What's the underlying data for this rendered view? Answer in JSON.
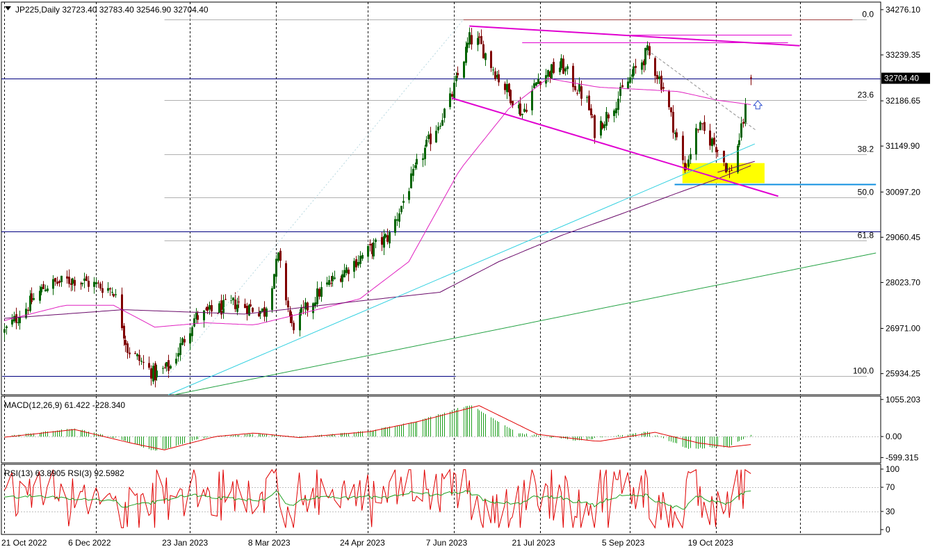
{
  "header": {
    "menu_icon": "triangle-down-icon",
    "symbol_line": "JP225,Daily  32723.40 32783.40 32546.90 32704.40"
  },
  "colors": {
    "bull_candle": "#006400",
    "bear_candle": "#800000",
    "ma_fast": "#e020c0",
    "ma_slow": "#6a0a6a",
    "trend_magenta": "#e000d0",
    "trend_cyan": "#30d0e0",
    "trend_green": "#20a040",
    "horizontal_navy": "#000080",
    "fib_grey": "#b0b0b0",
    "zone_yellow": "#ffff00",
    "support_blue": "#1090e0",
    "top_red": "#a04040",
    "macd_hist": "#20a020",
    "macd_signal": "#e00000",
    "rsi_fast": "#e00000",
    "rsi_slow": "#20a020",
    "price_tag_bg": "#000000",
    "cursor_arrow": "#3050d0"
  },
  "chart_data": [
    {
      "type": "candlestick",
      "name": "main",
      "symbol": "JP225",
      "timeframe": "Daily",
      "ohlc_current": {
        "open": 32723.4,
        "high": 32783.4,
        "low": 32546.9,
        "close": 32704.4
      },
      "current_price_label": "32704.40",
      "ylim": [
        25450,
        34450
      ],
      "y_ticks": [
        34276.1,
        33239.35,
        32186.65,
        31149.9,
        30097.2,
        29060.45,
        28023.7,
        26971.0,
        25934.25
      ],
      "y_tick_labels": [
        "34276.10",
        "33239.35",
        "32186.65",
        "31149.90",
        "30097.20",
        "29060.45",
        "28023.70",
        "26971.00",
        "25934.25"
      ],
      "x_labels": [
        "21 Oct 2022",
        "6 Dec 2022",
        "23 Jan 2023",
        "8 Mar 2023",
        "24 Apr 2023",
        "7 Jun 2023",
        "21 Jul 2023",
        "5 Sep 2023",
        "19 Oct 2023"
      ],
      "fib_levels": [
        {
          "label": "0.0",
          "price": 34050
        },
        {
          "label": "23.6",
          "price": 32200
        },
        {
          "label": "38.2",
          "price": 30960
        },
        {
          "label": "50.0",
          "price": 29980
        },
        {
          "label": "61.8",
          "price": 28980
        },
        {
          "label": "100.0",
          "price": 25880
        }
      ],
      "key_points": [
        {
          "date": "2022-10-20",
          "price": 26900
        },
        {
          "date": "2022-11-10",
          "price": 27950
        },
        {
          "date": "2022-11-25",
          "price": 28100
        },
        {
          "date": "2022-12-15",
          "price": 27850
        },
        {
          "date": "2022-12-22",
          "price": 26500
        },
        {
          "date": "2023-01-05",
          "price": 25900
        },
        {
          "date": "2023-01-13",
          "price": 26100
        },
        {
          "date": "2023-01-25",
          "price": 27200
        },
        {
          "date": "2023-02-15",
          "price": 27550
        },
        {
          "date": "2023-03-02",
          "price": 27350
        },
        {
          "date": "2023-03-09",
          "price": 28600
        },
        {
          "date": "2023-03-16",
          "price": 27000
        },
        {
          "date": "2023-03-30",
          "price": 27800
        },
        {
          "date": "2023-04-20",
          "price": 28600
        },
        {
          "date": "2023-05-05",
          "price": 29100
        },
        {
          "date": "2023-05-20",
          "price": 30800
        },
        {
          "date": "2023-06-05",
          "price": 32200
        },
        {
          "date": "2023-06-15",
          "price": 33600
        },
        {
          "date": "2023-06-20",
          "price": 33500
        },
        {
          "date": "2023-06-30",
          "price": 32700
        },
        {
          "date": "2023-07-12",
          "price": 31900
        },
        {
          "date": "2023-07-20",
          "price": 32700
        },
        {
          "date": "2023-08-01",
          "price": 33000
        },
        {
          "date": "2023-08-14",
          "price": 32150
        },
        {
          "date": "2023-08-18",
          "price": 31500
        },
        {
          "date": "2023-08-25",
          "price": 31900
        },
        {
          "date": "2023-09-05",
          "price": 32700
        },
        {
          "date": "2023-09-14",
          "price": 33300
        },
        {
          "date": "2023-09-22",
          "price": 32500
        },
        {
          "date": "2023-10-03",
          "price": 30600
        },
        {
          "date": "2023-10-10",
          "price": 31600
        },
        {
          "date": "2023-10-20",
          "price": 31100
        },
        {
          "date": "2023-10-26",
          "price": 30500
        },
        {
          "date": "2023-11-01",
          "price": 31500
        },
        {
          "date": "2023-11-06",
          "price": 32704
        }
      ],
      "ma_fast_points": [
        {
          "date": "2022-10-20",
          "price": 27150
        },
        {
          "date": "2022-11-20",
          "price": 27500
        },
        {
          "date": "2022-12-15",
          "price": 27500
        },
        {
          "date": "2023-01-05",
          "price": 27000
        },
        {
          "date": "2023-01-31",
          "price": 27100
        },
        {
          "date": "2023-02-25",
          "price": 27050
        },
        {
          "date": "2023-03-20",
          "price": 27300
        },
        {
          "date": "2023-04-20",
          "price": 27650
        },
        {
          "date": "2023-05-15",
          "price": 28500
        },
        {
          "date": "2023-06-10",
          "price": 30600
        },
        {
          "date": "2023-07-05",
          "price": 32000
        },
        {
          "date": "2023-07-25",
          "price": 32700
        },
        {
          "date": "2023-08-20",
          "price": 32500
        },
        {
          "date": "2023-09-10",
          "price": 32450
        },
        {
          "date": "2023-09-30",
          "price": 32400
        },
        {
          "date": "2023-10-20",
          "price": 32200
        },
        {
          "date": "2023-11-06",
          "price": 32100
        }
      ],
      "ma_slow_points": [
        {
          "date": "2022-10-20",
          "price": 27200
        },
        {
          "date": "2022-12-20",
          "price": 27400
        },
        {
          "date": "2023-02-20",
          "price": 27300
        },
        {
          "date": "2023-04-20",
          "price": 27600
        },
        {
          "date": "2023-05-31",
          "price": 27800
        },
        {
          "date": "2023-06-30",
          "price": 28500
        },
        {
          "date": "2023-08-01",
          "price": 29100
        },
        {
          "date": "2023-09-01",
          "price": 29600
        },
        {
          "date": "2023-10-01",
          "price": 30100
        },
        {
          "date": "2023-10-20",
          "price": 30400
        },
        {
          "date": "2023-11-06",
          "price": 30700
        }
      ],
      "trend_lines": [
        {
          "kind": "magenta-upper",
          "from": {
            "date": "2023-06-15",
            "price": 33900
          },
          "to": {
            "date": "2023-12-01",
            "price": 33450
          }
        },
        {
          "kind": "magenta-lower",
          "from": {
            "date": "2023-06-06",
            "price": 32250
          },
          "to": {
            "date": "2023-11-20",
            "price": 30000
          }
        },
        {
          "kind": "cyan",
          "from": {
            "date": "2023-01-12",
            "price": 25450
          },
          "to": {
            "date": "2023-11-08",
            "price": 31200
          }
        },
        {
          "kind": "green",
          "from": {
            "date": "2023-01-15",
            "price": 25450
          },
          "to": {
            "date": "2024-01-09",
            "price": 28700
          }
        },
        {
          "kind": "grey-dashed",
          "from": {
            "date": "2023-09-14",
            "price": 33350
          },
          "to": {
            "date": "2023-11-09",
            "price": 31500
          }
        },
        {
          "kind": "purple-short",
          "from": {
            "date": "2023-10-20",
            "price": 30550
          },
          "to": {
            "date": "2023-11-08",
            "price": 30800
          }
        },
        {
          "kind": "cyan-dotted-guide",
          "from": {
            "date": "2023-01-12",
            "price": 25900
          },
          "to": {
            "date": "2023-06-12",
            "price": 34050
          }
        }
      ],
      "horizontal_lines": [
        {
          "kind": "navy-price",
          "price": 32704.4
        },
        {
          "kind": "navy-mid",
          "price": 29200
        },
        {
          "kind": "navy-low",
          "from": "2022-10-19",
          "to": "2023-06-08",
          "price": 25880
        },
        {
          "kind": "red-top",
          "from": "2023-06-12",
          "to": "2023-12-28",
          "price": 34050
        },
        {
          "kind": "magenta-thin-1",
          "from": "2023-09-01",
          "to": "2023-11-27",
          "price": 33700
        },
        {
          "kind": "magenta-thin-2",
          "from": "2023-07-12",
          "to": "2023-11-25",
          "price": 33520
        },
        {
          "kind": "support-blue",
          "from": "2023-09-28",
          "to": "2024-01-09",
          "price": 30280
        }
      ],
      "zones": [
        {
          "kind": "yellow-support",
          "from": "2023-10-02",
          "to": "2023-11-13",
          "price_low": 30300,
          "price_high": 30760
        }
      ]
    },
    {
      "type": "bar",
      "name": "macd",
      "title": "MACD(12,26,9) 61.422 -228.340",
      "y_tick_labels": [
        "1055.203",
        "0.00",
        "-599.315"
      ],
      "ylim": [
        -750,
        1150
      ],
      "histogram_key_points": [
        {
          "date": "2022-10-20",
          "value": 0
        },
        {
          "date": "2022-11-25",
          "value": 230
        },
        {
          "date": "2022-12-20",
          "value": -100
        },
        {
          "date": "2023-01-05",
          "value": -420
        },
        {
          "date": "2023-01-31",
          "value": -20
        },
        {
          "date": "2023-02-25",
          "value": 90
        },
        {
          "date": "2023-03-20",
          "value": -20
        },
        {
          "date": "2023-04-25",
          "value": 160
        },
        {
          "date": "2023-05-20",
          "value": 450
        },
        {
          "date": "2023-06-15",
          "value": 900
        },
        {
          "date": "2023-07-10",
          "value": 100
        },
        {
          "date": "2023-08-10",
          "value": -120
        },
        {
          "date": "2023-09-14",
          "value": 140
        },
        {
          "date": "2023-10-05",
          "value": -350
        },
        {
          "date": "2023-10-26",
          "value": -280
        },
        {
          "date": "2023-11-06",
          "value": 61
        }
      ],
      "signal_key_points": [
        {
          "date": "2022-10-20",
          "value": -20
        },
        {
          "date": "2022-11-25",
          "value": 200
        },
        {
          "date": "2022-12-25",
          "value": -200
        },
        {
          "date": "2023-01-10",
          "value": -380
        },
        {
          "date": "2023-02-05",
          "value": 0
        },
        {
          "date": "2023-02-25",
          "value": 100
        },
        {
          "date": "2023-03-20",
          "value": -30
        },
        {
          "date": "2023-04-25",
          "value": 140
        },
        {
          "date": "2023-05-20",
          "value": 430
        },
        {
          "date": "2023-06-20",
          "value": 880
        },
        {
          "date": "2023-07-20",
          "value": 60
        },
        {
          "date": "2023-08-20",
          "value": -140
        },
        {
          "date": "2023-09-18",
          "value": 120
        },
        {
          "date": "2023-10-10",
          "value": -180
        },
        {
          "date": "2023-10-26",
          "value": -300
        },
        {
          "date": "2023-11-06",
          "value": -228
        }
      ]
    },
    {
      "type": "line",
      "name": "rsi",
      "title": "RSI(13) 63.8905  RSI(3) 92.5982",
      "y_ticks": [
        100,
        70,
        30,
        0
      ],
      "y_tick_labels": [
        "100",
        "70",
        "30",
        "0"
      ],
      "ylim": [
        -8,
        108
      ],
      "series": [
        {
          "name": "RSI(13)",
          "values_note": "oscillating 35-75",
          "last": 63.8905
        },
        {
          "name": "RSI(3)",
          "values_note": "oscillating 5-100",
          "last": 92.5982
        }
      ]
    }
  ]
}
